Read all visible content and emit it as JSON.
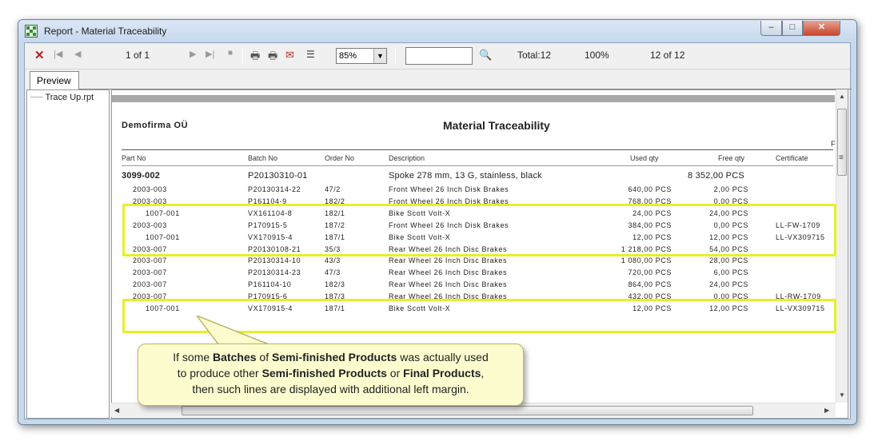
{
  "window": {
    "title": "Report - Material Traceability",
    "controls": [
      "minimize-button",
      "maximize-button",
      "close-button"
    ]
  },
  "toolbar": {
    "page_indicator": "1 of 1",
    "zoom": "85%",
    "search_value": "",
    "total": "Total:12",
    "percent": "100%",
    "record_count": "12 of 12",
    "icons": [
      "close-x-icon",
      "first-page-icon",
      "prev-page-icon",
      "next-page-icon",
      "last-page-icon",
      "stop-icon",
      "print-icon",
      "print-setup-icon",
      "export-icon",
      "group-tree-icon",
      "binoculars-icon"
    ]
  },
  "tabs": [
    {
      "label": "Preview"
    }
  ],
  "tree": {
    "items": [
      {
        "label": "Trace Up.rpt"
      }
    ]
  },
  "report": {
    "company": "Demofirma OÜ",
    "title": "Material Traceability",
    "page_marker": "F",
    "columns": {
      "part_no": "Part No",
      "batch_no": "Batch No",
      "order_no": "Order No",
      "description": "Description",
      "used_qty": "Used qty",
      "free_qty": "Free qty",
      "certificate": "Certificate"
    },
    "main_row": {
      "part_no": "3099-002",
      "batch_no": "P20130310-01",
      "description": "Spoke 278 mm, 13 G, stainless, black",
      "free_qty": "8 352,00 PCS"
    },
    "rows": [
      {
        "part_no": "2003-003",
        "batch_no": "P20130314-22",
        "order_no": "47/2",
        "description": "Front Wheel 26 Inch Disk Brakes",
        "used_qty": "640,00 PCS",
        "free_qty": "2,00 PCS",
        "certificate": "",
        "indent": 1
      },
      {
        "part_no": "2003-003",
        "batch_no": "P161104-9",
        "order_no": "182/2",
        "description": "Front Wheel 26 Inch Disk Brakes",
        "used_qty": "768,00 PCS",
        "free_qty": "0,00 PCS",
        "certificate": "",
        "indent": 1
      },
      {
        "part_no": "1007-001",
        "batch_no": "VX161104-8",
        "order_no": "182/1",
        "description": "Bike Scott Volt-X",
        "used_qty": "24,00 PCS",
        "free_qty": "24,00 PCS",
        "certificate": "",
        "indent": 2
      },
      {
        "part_no": "2003-003",
        "batch_no": "P170915-5",
        "order_no": "187/2",
        "description": "Front Wheel 26 Inch Disk Brakes",
        "used_qty": "384,00 PCS",
        "free_qty": "0,00 PCS",
        "certificate": "LL-FW-1709",
        "indent": 1
      },
      {
        "part_no": "1007-001",
        "batch_no": "VX170915-4",
        "order_no": "187/1",
        "description": "Bike Scott Volt-X",
        "used_qty": "12,00 PCS",
        "free_qty": "12,00 PCS",
        "certificate": "LL-VX309715",
        "indent": 2
      },
      {
        "part_no": "2003-007",
        "batch_no": "P20130108-21",
        "order_no": "35/3",
        "description": "Rear Wheel 26 Inch Disc Brakes",
        "used_qty": "1 218,00 PCS",
        "free_qty": "54,00 PCS",
        "certificate": "",
        "indent": 1
      },
      {
        "part_no": "2003-007",
        "batch_no": "P20130314-10",
        "order_no": "43/3",
        "description": "Rear Wheel 26 Inch Disc Brakes",
        "used_qty": "1 080,00 PCS",
        "free_qty": "28,00 PCS",
        "certificate": "",
        "indent": 1
      },
      {
        "part_no": "2003-007",
        "batch_no": "P20130314-23",
        "order_no": "47/3",
        "description": "Rear Wheel 26 Inch Disc Brakes",
        "used_qty": "720,00 PCS",
        "free_qty": "6,00 PCS",
        "certificate": "",
        "indent": 1
      },
      {
        "part_no": "2003-007",
        "batch_no": "P161104-10",
        "order_no": "182/3",
        "description": "Rear Wheel 26 Inch Disc Brakes",
        "used_qty": "864,00 PCS",
        "free_qty": "24,00 PCS",
        "certificate": "",
        "indent": 1
      },
      {
        "part_no": "2003-007",
        "batch_no": "P170915-6",
        "order_no": "187/3",
        "description": "Rear Wheel 26 Inch Disc Brakes",
        "used_qty": "432,00 PCS",
        "free_qty": "0,00 PCS",
        "certificate": "LL-RW-1709",
        "indent": 1
      },
      {
        "part_no": "1007-001",
        "batch_no": "VX170915-4",
        "order_no": "187/1",
        "description": "Bike Scott Volt-X",
        "used_qty": "12,00 PCS",
        "free_qty": "12,00 PCS",
        "certificate": "LL-VX309715",
        "indent": 2
      }
    ]
  },
  "callout": {
    "line1_pre": "If some ",
    "line1_b1": "Batches",
    "line1_mid": " of ",
    "line1_b2": "Semi-finished Products",
    "line1_post": " was actually used",
    "line2_pre": "to produce other ",
    "line2_b1": "Semi-finished Products",
    "line2_mid": " or ",
    "line2_b2": "Final Products",
    "line2_post": ",",
    "line3": "then such lines are displayed with additional left margin."
  },
  "colors": {
    "highlight": "#e6f028",
    "callout_bg": "#fcfccf",
    "titlebar": "#c6d8ee"
  }
}
